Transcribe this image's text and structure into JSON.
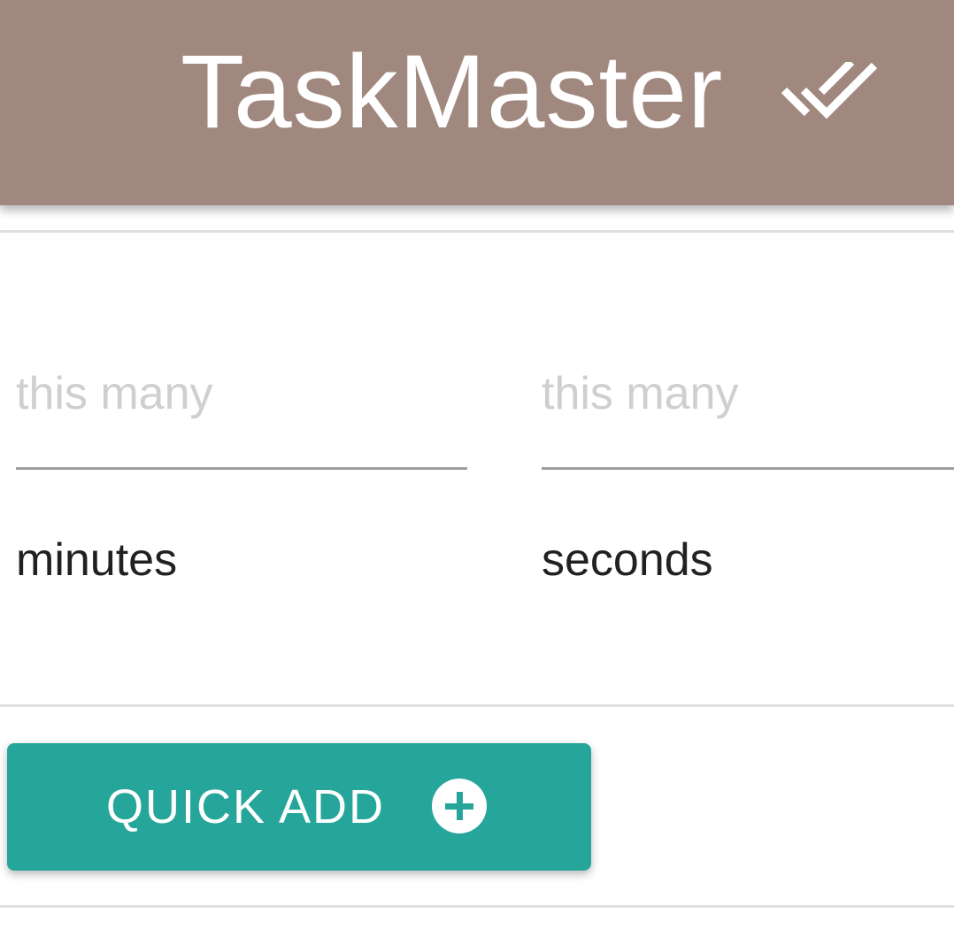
{
  "app": {
    "title": "TaskMaster",
    "title_icon": "done-all-icon"
  },
  "colors": {
    "app_bar": "#a1887f",
    "accent": "#26a69a",
    "placeholder": "#cfcfcf",
    "text": "#212121"
  },
  "duration": {
    "minutes": {
      "value": "",
      "placeholder": "this many",
      "unit_label": "minutes"
    },
    "seconds": {
      "value": "",
      "placeholder": "this many",
      "unit_label": "seconds"
    }
  },
  "actions": {
    "quick_add_label": "QUICK ADD",
    "quick_add_icon": "add-circle-icon"
  }
}
